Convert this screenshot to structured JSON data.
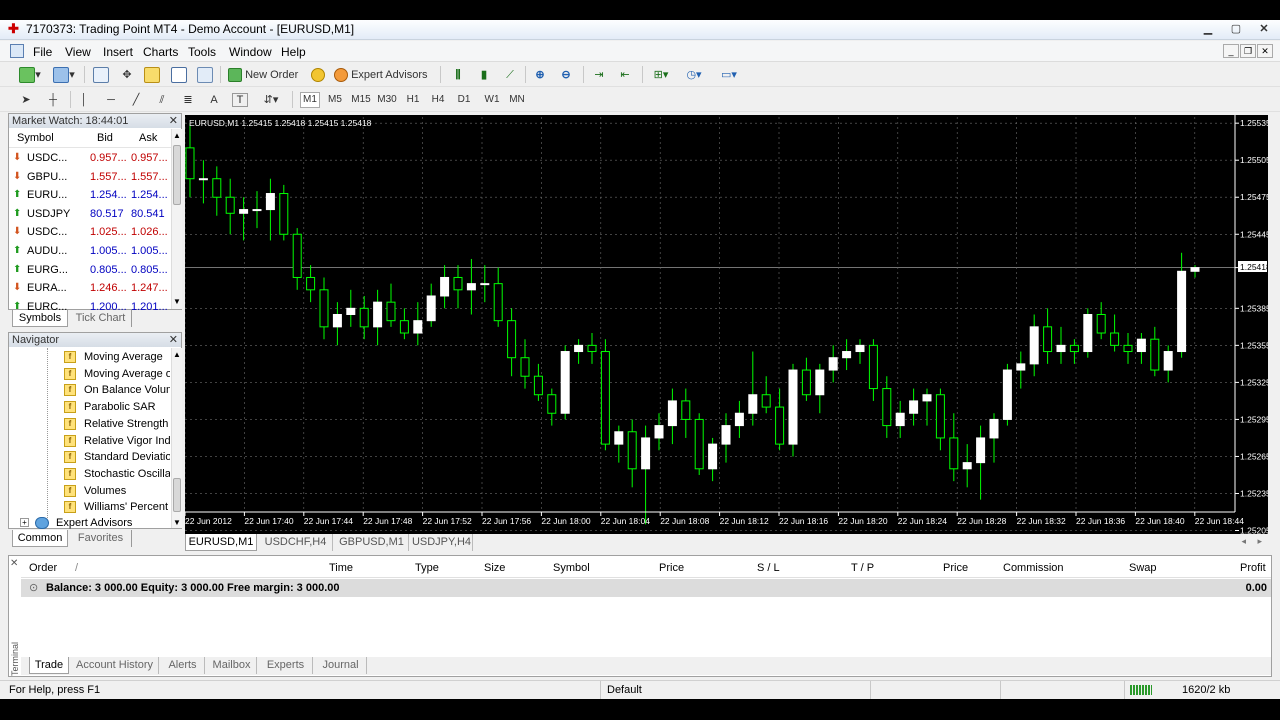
{
  "window": {
    "title": "7170373: Trading Point MT4 - Demo Account - [EURUSD,M1]",
    "controls": [
      "minimize-icon",
      "maximize-icon",
      "close-icon"
    ]
  },
  "menu": [
    "File",
    "View",
    "Insert",
    "Charts",
    "Tools",
    "Window",
    "Help"
  ],
  "toolbar": {
    "new_order": "New Order",
    "expert_advisors": "Expert Advisors",
    "text_tool": "A",
    "label_tool": "T",
    "timeframes": [
      "M1",
      "M5",
      "M15",
      "M30",
      "H1",
      "H4",
      "D1",
      "W1",
      "MN"
    ]
  },
  "market_watch": {
    "title": "Market Watch: 18:44:01",
    "columns": [
      "Symbol",
      "Bid",
      "Ask"
    ],
    "rows": [
      {
        "symbol": "USDC...",
        "bid": "0.957...",
        "ask": "0.957...",
        "dir": "down"
      },
      {
        "symbol": "GBPU...",
        "bid": "1.557...",
        "ask": "1.557...",
        "dir": "down"
      },
      {
        "symbol": "EURU...",
        "bid": "1.254...",
        "ask": "1.254...",
        "dir": "up"
      },
      {
        "symbol": "USDJPY",
        "bid": "80.517",
        "ask": "80.541",
        "dir": "up"
      },
      {
        "symbol": "USDC...",
        "bid": "1.025...",
        "ask": "1.026...",
        "dir": "down"
      },
      {
        "symbol": "AUDU...",
        "bid": "1.005...",
        "ask": "1.005...",
        "dir": "up"
      },
      {
        "symbol": "EURG...",
        "bid": "0.805...",
        "ask": "0.805...",
        "dir": "up"
      },
      {
        "symbol": "EURA...",
        "bid": "1.246...",
        "ask": "1.247...",
        "dir": "down"
      },
      {
        "symbol": "EURC...",
        "bid": "1.200...",
        "ask": "1.201...",
        "dir": "up"
      }
    ],
    "tabs": [
      "Symbols",
      "Tick Chart"
    ]
  },
  "navigator": {
    "title": "Navigator",
    "items": [
      "Moving Average",
      "Moving Average of",
      "On Balance Volume",
      "Parabolic SAR",
      "Relative Strength Index",
      "Relative Vigor Index",
      "Standard Deviation",
      "Stochastic Oscillator",
      "Volumes",
      "Williams' Percent Range"
    ],
    "root": "Expert Advisors",
    "tabs": [
      "Common",
      "Favorites"
    ]
  },
  "chart": {
    "header": "EURUSD,M1  1.25415 1.25418 1.25415 1.25418",
    "current_price": "1.25418",
    "tabs": [
      "EURUSD,M1",
      "USDCHF,H4",
      "GBPUSD,M1",
      "USDJPY,H4"
    ]
  },
  "chart_data": {
    "type": "candlestick",
    "symbol": "EURUSD",
    "timeframe": "M1",
    "ylim": [
      1.2522,
      1.2554
    ],
    "y_ticks": [
      "1.25535",
      "1.25505",
      "1.25475",
      "1.25445",
      "1.25418",
      "1.25385",
      "1.25355",
      "1.25325",
      "1.25295",
      "1.25265",
      "1.25235",
      "1.25205"
    ],
    "x_ticks": [
      "22 Jun 2012",
      "22 Jun 17:40",
      "22 Jun 17:44",
      "22 Jun 17:48",
      "22 Jun 17:52",
      "22 Jun 17:56",
      "22 Jun 18:00",
      "22 Jun 18:04",
      "22 Jun 18:08",
      "22 Jun 18:12",
      "22 Jun 18:16",
      "22 Jun 18:20",
      "22 Jun 18:24",
      "22 Jun 18:28",
      "22 Jun 18:32",
      "22 Jun 18:36",
      "22 Jun 18:40",
      "22 Jun 18:44"
    ],
    "ohlc": [
      [
        1.25515,
        1.25535,
        1.25475,
        1.2549
      ],
      [
        1.2549,
        1.25505,
        1.2547,
        1.2549
      ],
      [
        1.2549,
        1.255,
        1.2546,
        1.25475
      ],
      [
        1.25475,
        1.2549,
        1.25445,
        1.25462
      ],
      [
        1.25462,
        1.25475,
        1.2544,
        1.25465
      ],
      [
        1.25465,
        1.2548,
        1.2545,
        1.25465
      ],
      [
        1.25465,
        1.2549,
        1.2544,
        1.25478
      ],
      [
        1.25478,
        1.25485,
        1.2544,
        1.25445
      ],
      [
        1.25445,
        1.2545,
        1.254,
        1.2541
      ],
      [
        1.2541,
        1.2542,
        1.2539,
        1.254
      ],
      [
        1.254,
        1.2541,
        1.2536,
        1.2537
      ],
      [
        1.2537,
        1.2539,
        1.25355,
        1.2538
      ],
      [
        1.2538,
        1.254,
        1.2537,
        1.25385
      ],
      [
        1.25385,
        1.25395,
        1.2536,
        1.2537
      ],
      [
        1.2537,
        1.254,
        1.25355,
        1.2539
      ],
      [
        1.2539,
        1.25405,
        1.2537,
        1.25375
      ],
      [
        1.25375,
        1.25385,
        1.2536,
        1.25365
      ],
      [
        1.25365,
        1.2539,
        1.25355,
        1.25375
      ],
      [
        1.25375,
        1.25405,
        1.2537,
        1.25395
      ],
      [
        1.25395,
        1.2542,
        1.25385,
        1.2541
      ],
      [
        1.2541,
        1.2542,
        1.25385,
        1.254
      ],
      [
        1.254,
        1.25425,
        1.2538,
        1.25405
      ],
      [
        1.25405,
        1.2542,
        1.2539,
        1.25405
      ],
      [
        1.25405,
        1.25418,
        1.2537,
        1.25375
      ],
      [
        1.25375,
        1.25385,
        1.2533,
        1.25345
      ],
      [
        1.25345,
        1.2536,
        1.2532,
        1.2533
      ],
      [
        1.2533,
        1.2534,
        1.2531,
        1.25315
      ],
      [
        1.25315,
        1.2532,
        1.2529,
        1.253
      ],
      [
        1.253,
        1.25355,
        1.25295,
        1.2535
      ],
      [
        1.2535,
        1.2536,
        1.2534,
        1.25355
      ],
      [
        1.25355,
        1.25365,
        1.2534,
        1.2535
      ],
      [
        1.2535,
        1.2536,
        1.2527,
        1.25275
      ],
      [
        1.25275,
        1.2529,
        1.2526,
        1.25285
      ],
      [
        1.25285,
        1.25295,
        1.2524,
        1.25255
      ],
      [
        1.25255,
        1.2529,
        1.2521,
        1.2528
      ],
      [
        1.2528,
        1.253,
        1.2527,
        1.2529
      ],
      [
        1.2529,
        1.2532,
        1.25275,
        1.2531
      ],
      [
        1.2531,
        1.2532,
        1.2528,
        1.25295
      ],
      [
        1.25295,
        1.253,
        1.2525,
        1.25255
      ],
      [
        1.25255,
        1.2528,
        1.25245,
        1.25275
      ],
      [
        1.25275,
        1.253,
        1.2526,
        1.2529
      ],
      [
        1.2529,
        1.2531,
        1.2528,
        1.253
      ],
      [
        1.253,
        1.2535,
        1.2529,
        1.25315
      ],
      [
        1.25315,
        1.2533,
        1.253,
        1.25305
      ],
      [
        1.25305,
        1.2532,
        1.2527,
        1.25275
      ],
      [
        1.25275,
        1.2534,
        1.25265,
        1.25335
      ],
      [
        1.25335,
        1.25345,
        1.2531,
        1.25315
      ],
      [
        1.25315,
        1.2534,
        1.253,
        1.25335
      ],
      [
        1.25335,
        1.25355,
        1.25325,
        1.25345
      ],
      [
        1.25345,
        1.2536,
        1.25335,
        1.2535
      ],
      [
        1.2535,
        1.2536,
        1.2534,
        1.25355
      ],
      [
        1.25355,
        1.2536,
        1.2531,
        1.2532
      ],
      [
        1.2532,
        1.2533,
        1.2528,
        1.2529
      ],
      [
        1.2529,
        1.2531,
        1.2528,
        1.253
      ],
      [
        1.253,
        1.2532,
        1.2529,
        1.2531
      ],
      [
        1.2531,
        1.2532,
        1.2529,
        1.25315
      ],
      [
        1.25315,
        1.2532,
        1.2527,
        1.2528
      ],
      [
        1.2528,
        1.253,
        1.25245,
        1.25255
      ],
      [
        1.25255,
        1.25275,
        1.2524,
        1.2526
      ],
      [
        1.2526,
        1.2529,
        1.2523,
        1.2528
      ],
      [
        1.2528,
        1.253,
        1.2526,
        1.25295
      ],
      [
        1.25295,
        1.2534,
        1.2529,
        1.25335
      ],
      [
        1.25335,
        1.2535,
        1.2532,
        1.2534
      ],
      [
        1.2534,
        1.2538,
        1.2533,
        1.2537
      ],
      [
        1.2537,
        1.25385,
        1.2534,
        1.2535
      ],
      [
        1.2535,
        1.2537,
        1.2534,
        1.25355
      ],
      [
        1.25355,
        1.2536,
        1.2534,
        1.2535
      ],
      [
        1.2535,
        1.25385,
        1.25345,
        1.2538
      ],
      [
        1.2538,
        1.2539,
        1.2536,
        1.25365
      ],
      [
        1.25365,
        1.2538,
        1.2535,
        1.25355
      ],
      [
        1.25355,
        1.25365,
        1.2534,
        1.2535
      ],
      [
        1.2535,
        1.25365,
        1.2534,
        1.2536
      ],
      [
        1.2536,
        1.2537,
        1.2533,
        1.25335
      ],
      [
        1.25335,
        1.25355,
        1.25325,
        1.2535
      ],
      [
        1.2535,
        1.2543,
        1.25345,
        1.25415
      ],
      [
        1.25415,
        1.2542,
        1.2541,
        1.25418
      ]
    ]
  },
  "terminal": {
    "side_label": "Terminal",
    "columns": [
      "Order",
      "/",
      "Time",
      "Type",
      "Size",
      "Symbol",
      "Price",
      "S / L",
      "T / P",
      "Price",
      "Commission",
      "Swap",
      "Profit"
    ],
    "balance": "Balance: 3 000.00  Equity: 3 000.00  Free margin: 3 000.00",
    "profit": "0.00",
    "tabs": [
      "Trade",
      "Account History",
      "Alerts",
      "Mailbox",
      "Experts",
      "Journal"
    ]
  },
  "status": {
    "help": "For Help, press F1",
    "profile": "Default",
    "traffic": "1620/2 kb"
  },
  "colors": {
    "chart_bg": "#000000",
    "grid": "#6b6b6b",
    "bull_candle": "#ffffff",
    "bear_candle": "#000000",
    "wick": "#00ff00",
    "axis_text": "#ffffff",
    "price_up": "#0000c0",
    "price_down": "#c00000"
  }
}
